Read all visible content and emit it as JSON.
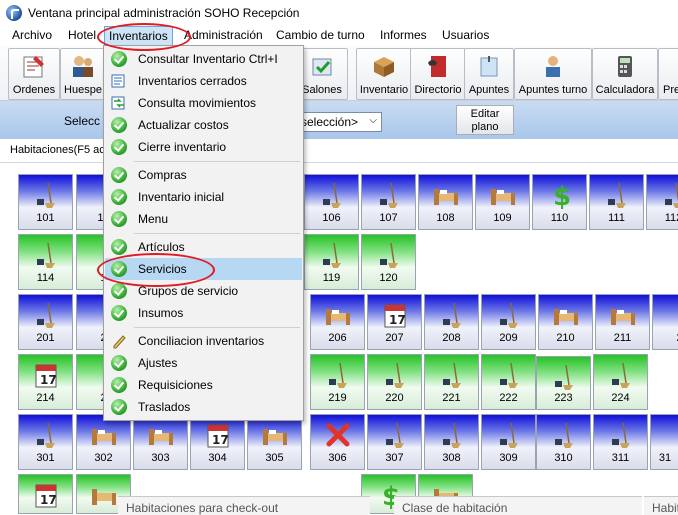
{
  "window": {
    "title": "Ventana principal administración SOHO Recepción"
  },
  "menubar": {
    "items": [
      "Archivo",
      "Hotel",
      "Inventarios",
      "Administración",
      "Cambio de turno",
      "Informes",
      "Usuarios"
    ]
  },
  "toolbar": {
    "items": [
      "Ordenes",
      "Huespe",
      "Salones",
      "Inventario",
      "Directorio",
      "Apuntes",
      "Apuntes turno",
      "Calculadora",
      "Pre"
    ]
  },
  "selector": {
    "label": "Selecc",
    "value": "selección>",
    "edit_button": "Editar plano"
  },
  "rooms_header": "Habitaciones(F5 ac",
  "dropdown": {
    "items": [
      "Consultar Inventario Ctrl+I",
      "Inventarios cerrados",
      "Consulta movimientos",
      "Actualizar costos",
      "Cierre inventario",
      "Compras",
      "Inventario inicial",
      "Menu",
      "Artículos",
      "Servicios",
      "Grupos de servicio",
      "Insumos",
      "Conciliacion inventarios",
      "Ajustes",
      "Requisiciones",
      "Traslados"
    ],
    "highlighted": "Servicios"
  },
  "rooms": {
    "row1": [
      "101",
      "10",
      "106",
      "107",
      "108",
      "109",
      "110",
      "111",
      "112"
    ],
    "row2": [
      "114",
      "1",
      "119",
      "120"
    ],
    "row3": [
      "201",
      "2",
      "206",
      "207",
      "208",
      "209",
      "210",
      "211",
      "2"
    ],
    "row4": [
      "214",
      "2",
      "219",
      "220",
      "221",
      "222",
      "223",
      "224"
    ],
    "row5": [
      "301",
      "302",
      "303",
      "304",
      "305",
      "306",
      "307",
      "308",
      "309",
      "310",
      "311",
      "31"
    ],
    "row6": []
  },
  "bottom": {
    "checkout": "Habitaciones para check-out",
    "room_class": "Clase de habitación",
    "right": "Habit"
  },
  "colors": {
    "highlight_circle": "#e01b24",
    "menu_highlight": "#b7d8f2"
  }
}
